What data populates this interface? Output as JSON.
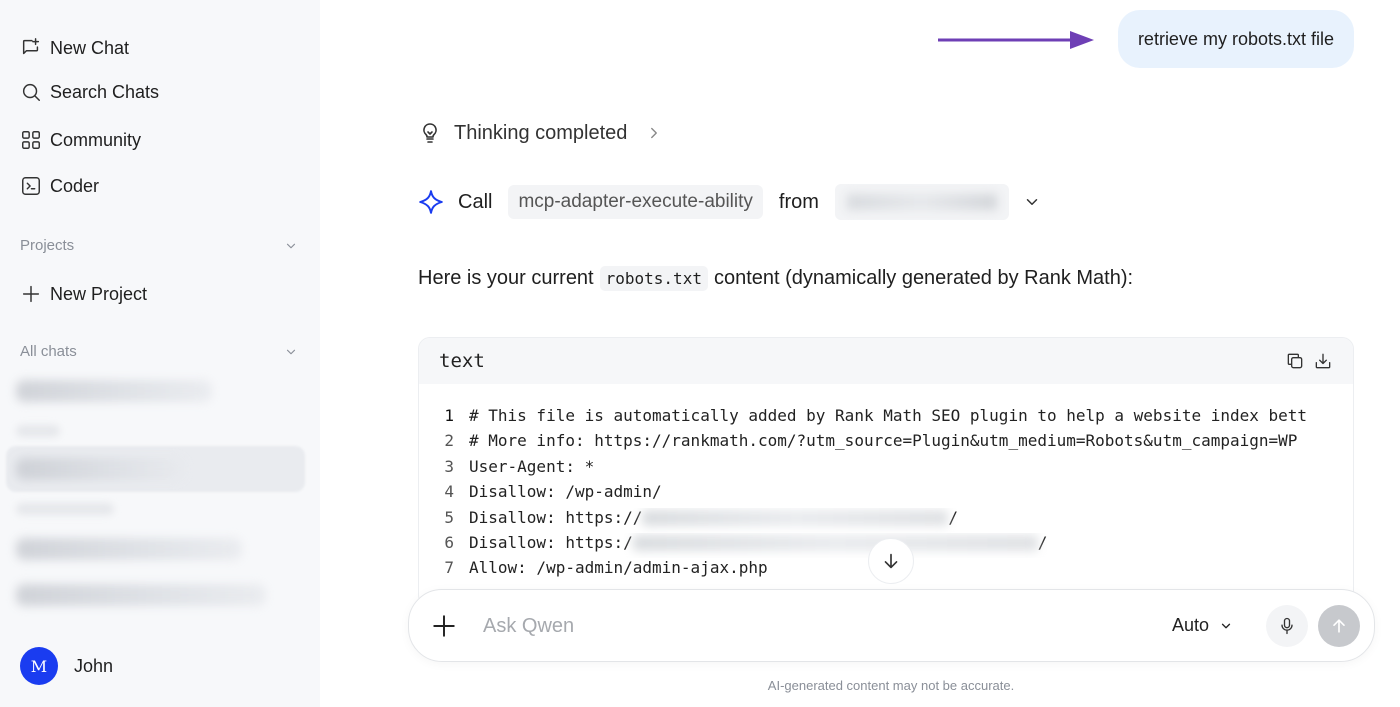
{
  "sidebar": {
    "new_chat": "New Chat",
    "search_chats": "Search Chats",
    "community": "Community",
    "coder": "Coder",
    "projects_label": "Projects",
    "new_project": "New Project",
    "all_chats_label": "All chats",
    "user_initial": "M",
    "user_name": "John"
  },
  "conversation": {
    "user_message": "retrieve my robots.txt file",
    "thinking_status": "Thinking completed",
    "call_label": "Call",
    "tool_name": "mcp-adapter-execute-ability",
    "from_label": "from",
    "intro_before": "Here is your current",
    "intro_code": "robots.txt",
    "intro_after": "content (dynamically generated by Rank Math):"
  },
  "code_block": {
    "language": "text",
    "lines": [
      {
        "n": "1",
        "text": "# This file is automatically added by Rank Math SEO plugin to help a website index bett"
      },
      {
        "n": "2",
        "text": "# More info: https://rankmath.com/?utm_source=Plugin&utm_medium=Robots&utm_campaign=WP"
      },
      {
        "n": "3",
        "text": "User-Agent: *"
      },
      {
        "n": "4",
        "text": "Disallow: /wp-admin/"
      },
      {
        "n": "5",
        "text": "Disallow: https://",
        "tail": "/"
      },
      {
        "n": "6",
        "text": "Disallow: https:/",
        "tail": "/"
      },
      {
        "n": "7",
        "text": "Allow: /wp-admin/admin-ajax.php"
      }
    ]
  },
  "composer": {
    "placeholder": "Ask Qwen",
    "mode": "Auto"
  },
  "disclaimer": "AI-generated content may not be accurate.",
  "colors": {
    "accent_blue": "#1a3cf0",
    "arrow_purple": "#6e3fb5",
    "user_bubble": "#e8f2fd"
  }
}
